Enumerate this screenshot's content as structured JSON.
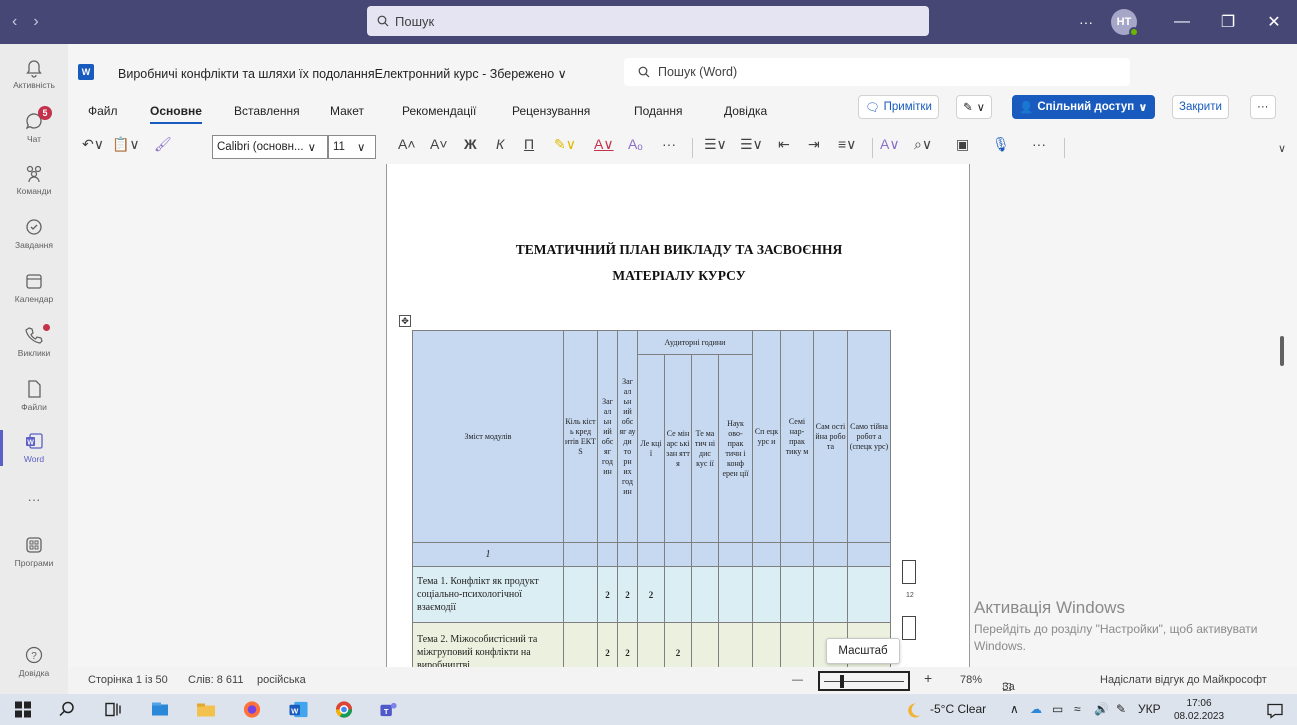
{
  "teams": {
    "search_placeholder": "Пошук",
    "avatar_initials": "НТ",
    "more": "···",
    "window": {
      "minimize": "—",
      "restore": "❐",
      "close": "✕"
    }
  },
  "rail": [
    {
      "label": "Активність",
      "icon": "bell-icon"
    },
    {
      "label": "Чат",
      "icon": "chat-icon",
      "badge": "5"
    },
    {
      "label": "Команди",
      "icon": "teams-icon"
    },
    {
      "label": "Завдання",
      "icon": "tasks-icon"
    },
    {
      "label": "Календар",
      "icon": "calendar-icon"
    },
    {
      "label": "Виклики",
      "icon": "phone-icon"
    },
    {
      "label": "Файли",
      "icon": "file-icon"
    },
    {
      "label": "Word",
      "icon": "word-icon"
    },
    {
      "label": "···",
      "icon": "more-icon"
    },
    {
      "label": "Програми",
      "icon": "apps-icon"
    },
    {
      "label": "Довідка",
      "icon": "help-icon"
    }
  ],
  "word": {
    "doc_title": "Виробничі конфлікти та шляхи їх подоланняЕлектронний курс - Збережено",
    "search_placeholder": "Пошук (Word)",
    "tabs": [
      "Файл",
      "Основне",
      "Вставлення",
      "Макет",
      "Рекомендації",
      "Рецензування",
      "Подання",
      "Довідка"
    ],
    "buttons": {
      "comments": "Примітки",
      "share": "Спільний доступ",
      "close": "Закрити"
    },
    "font_name": "Calibri (основн...",
    "font_size": "11",
    "format": {
      "grow": "A˄",
      "shrink": "A˅",
      "bold": "Ж",
      "italic": "К",
      "underline": "П"
    }
  },
  "document": {
    "heading_line1": "ТЕМАТИЧНИЙ ПЛАН ВИКЛАДУ ТА ЗАСВОЄННЯ",
    "heading_line2": "МАТЕРІАЛУ КУРСУ",
    "table": {
      "col_content": "Зміст модулів",
      "col_credits": "Кіль кіст ь кред итів ЕКТ S",
      "col_total": "Заг ал ьн ий обс яг год ин",
      "col_aud_total": "Заг ал ьн ий обс яг ау ди то рн их год ин",
      "group_aud": "Аудиторні години",
      "col_lect": "Ле кці ї",
      "col_sem": "Се мін арс ькі зан ятт я",
      "col_thematic": "Те ма тич ні дис кус ії",
      "col_conf": "Наук ово- прак тичн і конф ерен ції",
      "col_special": "Сп ецк урс и",
      "col_workshop": "Семі нар- прак тику м",
      "col_selfwork": "Сам ості йна робо та",
      "col_indep": "Само тійна робот а (спецк урс)",
      "row_index": "1",
      "rows": [
        {
          "theme": "Тема 1. Конфлікт як продукт соціально-психологічної взаємодії",
          "total": "2",
          "aud": "2",
          "lect": "2",
          "sem": ""
        },
        {
          "theme": "Тема 2. Міжособистісний та міжгруповий конфлікти на виробництві",
          "total": "2",
          "aud": "2",
          "lect": "",
          "sem": "2"
        }
      ]
    }
  },
  "overlays": {
    "activation_title": "Активація Windows",
    "activation_text": "Перейдіть до розділу \"Настройки\", щоб активувати Windows.",
    "comment_number": "12",
    "zoom_tooltip": "Масштаб"
  },
  "status": {
    "page": "Сторінка 1 із 50",
    "words": "Слів: 8 611",
    "language": "російська",
    "zoom_minus": "—",
    "zoom_plus": "+",
    "zoom_value": "78%",
    "fit_width": "За шириною",
    "feedback": "Надіслати відгук до Майкрософт",
    "zoom_level": 0.2
  },
  "taskbar": {
    "weather": "-5°C  Clear",
    "language": "УКР",
    "time": "17:06",
    "date": "08.02.2023"
  },
  "colors": {
    "teams_bar": "#464775",
    "word_blue": "#185abd",
    "table_header": "#c6d9f1"
  }
}
